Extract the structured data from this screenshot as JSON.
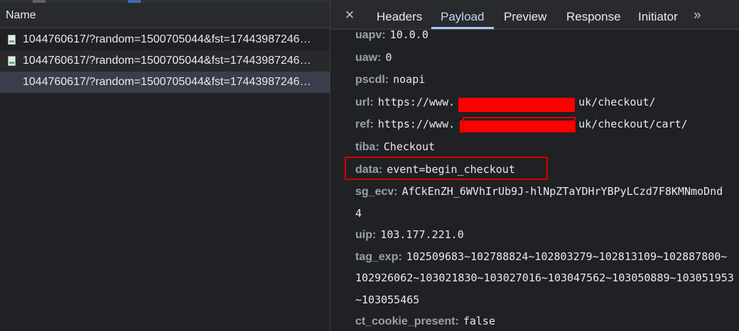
{
  "requests": {
    "column_header": "Name",
    "rows": [
      {
        "name": "1044760617/?random=1500705044&fst=17443987246…",
        "state": "normal"
      },
      {
        "name": "1044760617/?random=1500705044&fst=17443987246…",
        "state": "alt"
      },
      {
        "name": "1044760617/?random=1500705044&fst=17443987246…",
        "state": "selected"
      }
    ]
  },
  "tabs": {
    "close_icon": "×",
    "items": [
      "Headers",
      "Payload",
      "Preview",
      "Response",
      "Initiator"
    ],
    "active": "Payload",
    "more_icon": "»"
  },
  "payload": {
    "uapv": {
      "key": "uapv:",
      "value": "10.0.0"
    },
    "uaw": {
      "key": "uaw:",
      "value": "0"
    },
    "pscdl": {
      "key": "pscdl:",
      "value": "noapi"
    },
    "url": {
      "key": "url:",
      "value_prefix": "https://www.",
      "value_suffix": "uk/checkout/"
    },
    "ref": {
      "key": "ref:",
      "value_prefix": "https://www.",
      "value_suffix": "uk/checkout/cart/"
    },
    "tiba": {
      "key": "tiba:",
      "value": "Checkout"
    },
    "data": {
      "key": "data:",
      "value": "event=begin_checkout"
    },
    "sg_ecv": {
      "key": "sg_ecv:",
      "value": "AfCkEnZH_6WVhIrUb9J-hlNpZTaYDHrYBPyLCzd7F8KMNmoDnd",
      "continuation": "4"
    },
    "uip": {
      "key": "uip:",
      "value": "103.177.221.0"
    },
    "tag_exp": {
      "key": "tag_exp:",
      "value": "102509683~102788824~102803279~102813109~102887800~",
      "continuation_1": "102926062~103021830~103027016~103047562~103050889~103051953",
      "continuation_2": "~103055465"
    },
    "ct_cookie_present": {
      "key": "ct_cookie_present:",
      "value": "false"
    }
  },
  "colors": {
    "panel_bg": "#202124",
    "header_bg": "#292a2d",
    "selected_row": "#3b3d4a",
    "accent": "#a8c7fa",
    "redaction": "#ff0000"
  }
}
